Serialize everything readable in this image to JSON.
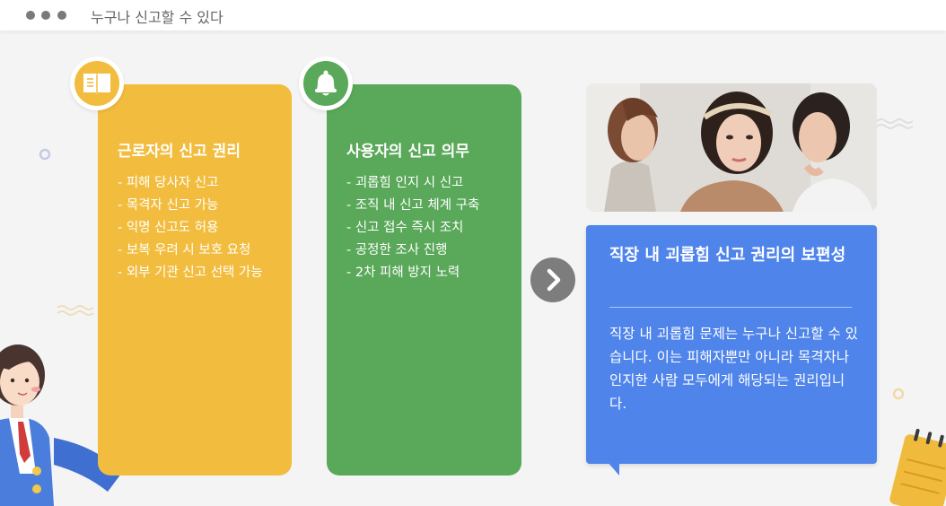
{
  "window": {
    "title": "누구나 신고할 수 있다"
  },
  "cards": [
    {
      "title": "근로자의 신고 권리",
      "items": [
        "- 피해 당사자 신고",
        "- 목격자 신고 가능",
        "- 익명 신고도 허용",
        "- 보복 우려 시 보호 요청",
        "- 외부 기관 신고 선택 가능"
      ],
      "icon": "book-icon",
      "color": "#f2bd3f"
    },
    {
      "title": "사용자의 신고 의무",
      "items": [
        "- 괴롭힘 인지 시 신고",
        "- 조직 내 신고 체계 구축",
        "- 신고 접수 즉시 조치",
        "- 공정한 조사 진행",
        "- 2차 피해 방지 노력"
      ],
      "icon": "bell-icon",
      "color": "#5aa85a"
    }
  ],
  "next_button": {
    "icon": "chevron-right-icon"
  },
  "summary": {
    "title": "직장 내 괴롭힘 신고 권리의 보편성",
    "body": "직장 내 괴롭힘 문제는 누구나 신고할 수 있습니다. 이는 피해자뿐만 아니라 목격자나 인지한 사람 모두에게 해당되는 권리입니다.",
    "color": "#4f84eb"
  }
}
